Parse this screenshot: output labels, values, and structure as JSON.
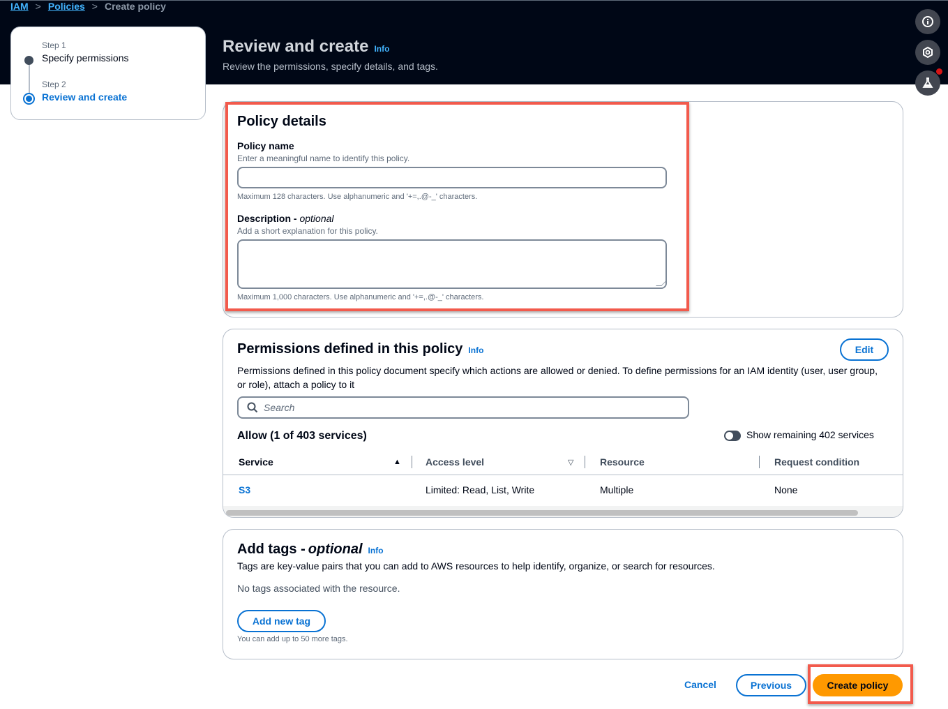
{
  "breadcrumb": {
    "items": [
      "IAM",
      "Policies"
    ],
    "current": "Create policy"
  },
  "steps": [
    {
      "label": "Step 1",
      "title": "Specify permissions",
      "state": "completed"
    },
    {
      "label": "Step 2",
      "title": "Review and create",
      "state": "active"
    }
  ],
  "header": {
    "title": "Review and create",
    "info": "Info",
    "description": "Review the permissions, specify details, and tags."
  },
  "side_buttons": [
    {
      "icon": "info-icon"
    },
    {
      "icon": "settings-hexagon-icon"
    },
    {
      "icon": "lab-flask-icon",
      "notification": true
    }
  ],
  "policy_details": {
    "heading": "Policy details",
    "name": {
      "label": "Policy name",
      "description": "Enter a meaningful name to identify this policy.",
      "value": "",
      "constraint": "Maximum 128 characters. Use alphanumeric and '+=,.@-_' characters."
    },
    "description": {
      "label": "Description - ",
      "label_optional": "optional",
      "description": "Add a short explanation for this policy.",
      "value": "",
      "constraint": "Maximum 1,000 characters. Use alphanumeric and '+=,.@-_' characters."
    }
  },
  "permissions": {
    "heading": "Permissions defined in this policy",
    "info": "Info",
    "edit_label": "Edit",
    "description": "Permissions defined in this policy document specify which actions are allowed or denied. To define permissions for an IAM identity (user, user group, or role), attach a policy to it",
    "search_placeholder": "Search",
    "allow_heading": "Allow (1 of 403 services)",
    "toggle_label": "Show remaining 402 services",
    "toggle_on": false,
    "columns": [
      "Service",
      "Access level",
      "Resource",
      "Request condition"
    ],
    "rows": [
      {
        "service": "S3",
        "access_level": "Limited: Read, List, Write",
        "resource": "Multiple",
        "request_condition": "None"
      }
    ]
  },
  "tags": {
    "heading": "Add tags - ",
    "heading_optional": "optional",
    "info": "Info",
    "description": "Tags are key-value pairs that you can add to AWS resources to help identify, organize, or search for resources.",
    "empty": "No tags associated with the resource.",
    "add_label": "Add new tag",
    "limit": "You can add up to 50 more tags."
  },
  "footer": {
    "cancel": "Cancel",
    "previous": "Previous",
    "create": "Create policy"
  },
  "colors": {
    "accent": "#0972d3",
    "primary": "#ff9900",
    "highlight": "#f25a4c",
    "header_bg": "#000716"
  }
}
